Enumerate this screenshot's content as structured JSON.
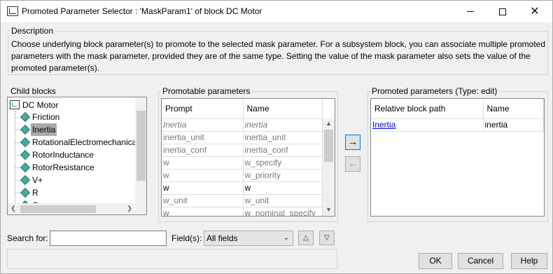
{
  "window": {
    "title": "Promoted Parameter Selector : 'MaskParam1' of block DC Motor",
    "min_symbol": "—",
    "close_symbol": "✕"
  },
  "description": {
    "label": "Description",
    "text": "Choose underlying block parameter(s) to promote to the selected mask parameter. For a subsystem block, you can associate multiple promoted parameters with the mask parameter, provided they are of the same type. Setting the value of the mask parameter also sets the value of the promoted parameter(s)."
  },
  "child_blocks": {
    "label": "Child blocks",
    "root": "DC Motor",
    "items": [
      "Friction",
      "Inertia",
      "RotationalElectromechanica",
      "RotorInductance",
      "RotorResistance",
      "V+",
      "R",
      "C"
    ],
    "selected": "Inertia"
  },
  "promotable": {
    "label": "Promotable parameters",
    "columns": [
      "Prompt",
      "Name"
    ],
    "rows": [
      {
        "prompt": "Inertia",
        "name": "inertia"
      },
      {
        "prompt": "inertia_unit",
        "name": "inertia_unit"
      },
      {
        "prompt": "inertia_conf",
        "name": "inertia_conf"
      },
      {
        "prompt": "w",
        "name": "w_specify"
      },
      {
        "prompt": "w",
        "name": "w_priority"
      },
      {
        "prompt": "w",
        "name": "w"
      },
      {
        "prompt": "w_unit",
        "name": "w_unit"
      },
      {
        "prompt": "w",
        "name": "w_nominal_specify"
      }
    ]
  },
  "transfer": {
    "add_symbol": "→",
    "remove_symbol": "←"
  },
  "promoted": {
    "label": "Promoted parameters (Type: edit)",
    "columns": [
      "Relative block path",
      "Name"
    ],
    "rows": [
      {
        "path": "Inertia",
        "name": "inertia"
      }
    ]
  },
  "search": {
    "label": "Search for:",
    "value": "",
    "fields_label": "Field(s):",
    "fields_value": "All fields"
  },
  "buttons": {
    "ok": "OK",
    "cancel": "Cancel",
    "help": "Help"
  }
}
